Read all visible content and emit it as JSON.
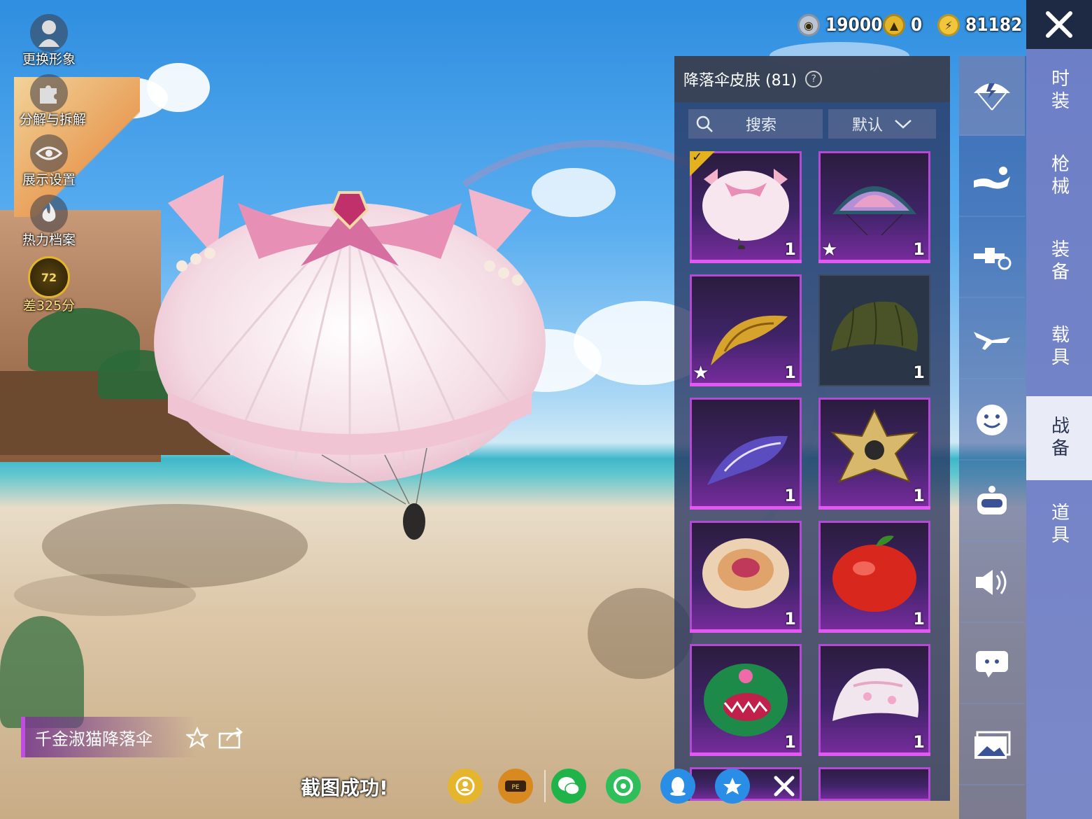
{
  "currency": [
    {
      "icon": "silver-coin-icon",
      "value": "19000"
    },
    {
      "icon": "gold-token-icon",
      "value": "0"
    },
    {
      "icon": "lightning-coin-icon",
      "value": "81182"
    }
  ],
  "left_menu": [
    {
      "icon": "avatar-icon",
      "label": "更换形象"
    },
    {
      "icon": "puzzle-icon",
      "label": "分解与拆解"
    },
    {
      "icon": "eye-icon",
      "label": "展示设置"
    },
    {
      "icon": "flame-icon",
      "label": "热力档案"
    },
    {
      "icon": "level-badge-icon",
      "badge": "72",
      "label": "差325分"
    }
  ],
  "panel": {
    "title": "降落伞皮肤 (81)",
    "search_label": "搜索",
    "sort_label": "默认"
  },
  "items": [
    {
      "name": "pink-cat-parachute",
      "count": "1",
      "equipped": true,
      "starred": false
    },
    {
      "name": "glass-mosaic-parachute",
      "count": "1",
      "equipped": false,
      "starred": true
    },
    {
      "name": "golden-wing-parachute",
      "count": "1",
      "equipped": false,
      "starred": true
    },
    {
      "name": "olive-default-parachute",
      "count": "1",
      "equipped": false,
      "starred": false
    },
    {
      "name": "purple-ornate-parachute",
      "count": "1",
      "equipped": false,
      "starred": false
    },
    {
      "name": "gold-star-parachute",
      "count": "1",
      "equipped": false,
      "starred": false
    },
    {
      "name": "painted-dome-parachute",
      "count": "1",
      "equipped": false,
      "starred": false
    },
    {
      "name": "red-apple-parachute",
      "count": "1",
      "equipped": false,
      "starred": false
    },
    {
      "name": "monster-mouth-parachute",
      "count": "1",
      "equipped": false,
      "starred": false
    },
    {
      "name": "pastel-patchwork-parachute",
      "count": "1",
      "equipped": false,
      "starred": false
    }
  ],
  "category_icons": [
    "parachute-icon",
    "emote-icon",
    "drone-icon",
    "plane-icon",
    "sticker-face-icon",
    "robot-icon",
    "speaker-icon",
    "chat-bubble-icon",
    "gallery-icon"
  ],
  "tabs": [
    "时装",
    "枪械",
    "装备",
    "载具",
    "战备",
    "道具"
  ],
  "active_tab": "战备",
  "selected_item_name": "千金淑猫降落伞",
  "toast": "截图成功!",
  "share_targets": [
    "friends-icon",
    "peace-elite-icon",
    "wechat-icon",
    "moments-icon",
    "qq-icon",
    "qzone-icon",
    "close-share-icon"
  ],
  "colors": {
    "accent_purple": "#e258f0",
    "equipped_gold": "#e4b21c",
    "rail_blue": "#6d7fc7"
  }
}
